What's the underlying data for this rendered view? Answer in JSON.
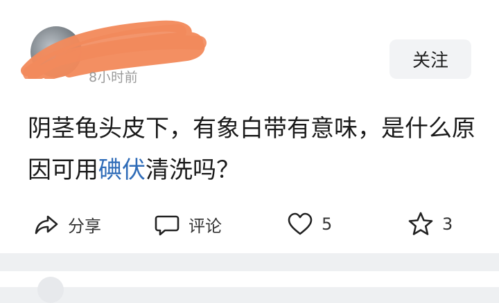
{
  "post": {
    "author_name": "",
    "timestamp": "8小时前",
    "follow_label": "关注",
    "text_before": "阴茎龟头皮下，有象白带有意味，是什么原因可用",
    "text_link": "碘伏",
    "text_after": "清洗吗？"
  },
  "actions": {
    "share_label": "分享",
    "comment_label": "评论",
    "like_count": "5",
    "favorite_count": "3"
  },
  "icons": {
    "share": "share-arrow-icon",
    "comment": "comment-bubble-icon",
    "like": "heart-icon",
    "favorite": "star-icon"
  },
  "colors": {
    "link": "#2f6cb8",
    "scribble": "#f28a5c",
    "background": "#eef0f2"
  }
}
